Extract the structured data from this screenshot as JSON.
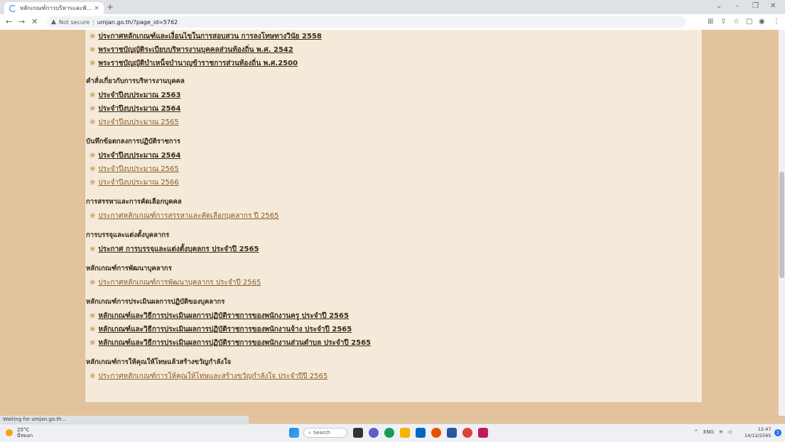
{
  "browser": {
    "tab_title": "หลักเกณฑ์การบริหารและพัฒนาทรัพย",
    "tab_close": "×",
    "new_tab": "+",
    "window_controls": [
      "⌄",
      "–",
      "❐",
      "✕"
    ],
    "address": {
      "security": "Not secure",
      "url": "umjan.go.th/?page_id=5762"
    },
    "status": "Waiting for umjan.go.th..."
  },
  "content": {
    "top_items": [
      {
        "label": "ประกาศหลักเกณฑ์และเงื่อนไขในการสอบสวน การลงโทษทางวินัย 2558",
        "visited": false
      },
      {
        "label": "พระราชบัญญัติระเบียบบริหารงานบุคคลส่วนท้องถิ่น พ.ศ. 2542",
        "visited": false
      },
      {
        "label": "พระราชบัญญัติบำเหน็จบำนาญข้าราชการส่วนท้องถิ่น พ.ศ.2500",
        "visited": false
      }
    ],
    "sections": [
      {
        "heading": "คำสั่งเกี่ยวกับการบริหารงานบุคคล",
        "items": [
          {
            "label": "ประจำปีงบประมาณ 2563",
            "visited": false
          },
          {
            "label": "ประจำปีงบประมาณ 2564",
            "visited": false
          },
          {
            "label": "ประจำปีงบประมาณ 2565",
            "visited": true
          }
        ]
      },
      {
        "heading": "บันทึกข้อตกลงการปฏิบัติราชการ",
        "items": [
          {
            "label": "ประจำปีงบประมาณ 2564",
            "visited": false
          },
          {
            "label": "ประจำปีงบประมาณ 2565",
            "visited": true
          },
          {
            "label": "ประจำปีงบประมาณ 2566",
            "visited": true
          }
        ]
      },
      {
        "heading": "การสรรหาและการคัดเลือกบุคคล",
        "items": [
          {
            "label": "ประกาศหลักเกณฑ์การสรรหาและคัดเลือกบุคลากร ปี 2565",
            "visited": true
          }
        ]
      },
      {
        "heading": "การบรรจุและแต่งตั้งบุคลากร",
        "items": [
          {
            "label": "ประกาศ การบรรจุและแต่งตั้งบุคลกร ประจำปี 2565",
            "visited": false
          }
        ]
      },
      {
        "heading": "หลักเกณฑ์การพัฒนาบุคลากร",
        "items": [
          {
            "label": "ประกาศหลักเกณฑ์การพัฒนาบุคลากร ประจำปี 2565",
            "visited": true
          }
        ]
      },
      {
        "heading": "หลักเกณฑ์การประเมินผลการปฏิบัติของบุคลากร",
        "items": [
          {
            "label": "หลักเกณฑ์และวิธีการประเมินผลการปฏิบัติราชการของพนักงานครู ประจำปี 2565",
            "visited": false
          },
          {
            "label": "หลักเกณฑ์และวิธีการประเมินผลการปฏิบัติราชการของพนักงานจ้าง ประจำปี 2565",
            "visited": false
          },
          {
            "label": "หลักเกณฑ์และวิธีการประเมินผลการปฏิบัติราชการของพนักงานส่วนตำบล ประจำปี 2565",
            "visited": false
          }
        ]
      },
      {
        "heading": "หลักเกณฑ์การให้คุณให้โทษแล้วสร้างขวัญกำลังใจ",
        "items": [
          {
            "label": "ประกาศหลักเกณฑ์การให้คุณให้โทษและสร้างขวัญกำลังใจ ประจำปีปี 2565",
            "visited": true
          }
        ]
      }
    ]
  },
  "taskbar": {
    "weather_temp": "25°C",
    "weather_desc": "มีหมอก",
    "search_label": "Search",
    "tray_lang": "ENG",
    "time": "12:47",
    "date": "14/12/2565",
    "notifications": "1"
  },
  "colors": {
    "page_bg": "#e2c39b",
    "panel_bg": "#f5ead9",
    "link": "#3a2a12",
    "visited_link": "#8a5a2a",
    "bullet": "#c9a05c"
  }
}
